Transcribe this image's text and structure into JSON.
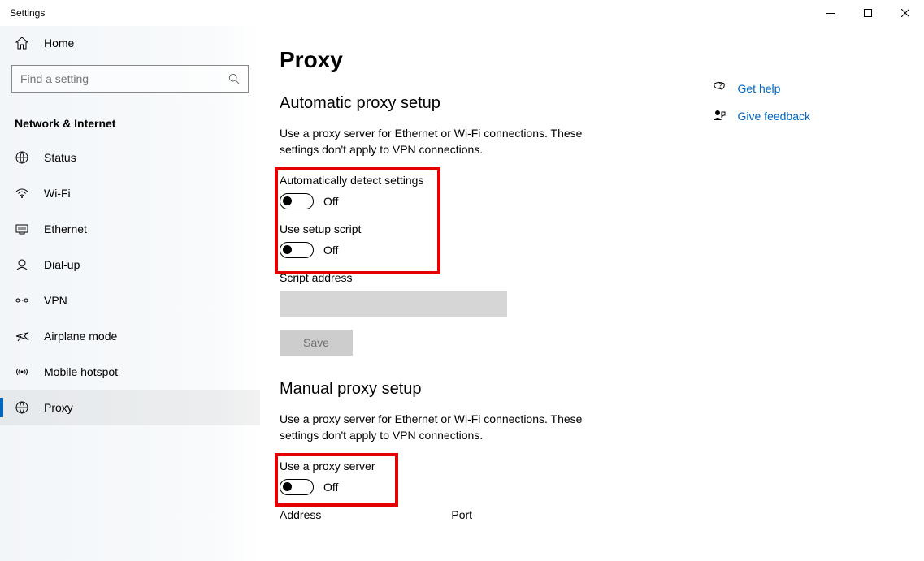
{
  "window": {
    "title": "Settings"
  },
  "sidebar": {
    "home_label": "Home",
    "search_placeholder": "Find a setting",
    "category": "Network & Internet",
    "items": [
      {
        "label": "Status",
        "icon": "status-icon"
      },
      {
        "label": "Wi-Fi",
        "icon": "wifi-icon"
      },
      {
        "label": "Ethernet",
        "icon": "ethernet-icon"
      },
      {
        "label": "Dial-up",
        "icon": "dialup-icon"
      },
      {
        "label": "VPN",
        "icon": "vpn-icon"
      },
      {
        "label": "Airplane mode",
        "icon": "airplane-icon"
      },
      {
        "label": "Mobile hotspot",
        "icon": "hotspot-icon"
      },
      {
        "label": "Proxy",
        "icon": "proxy-icon"
      }
    ]
  },
  "page": {
    "title": "Proxy",
    "auto": {
      "title": "Automatic proxy setup",
      "desc": "Use a proxy server for Ethernet or Wi-Fi connections. These settings don't apply to VPN connections.",
      "detect_label": "Automatically detect settings",
      "detect_state": "Off",
      "script_label": "Use setup script",
      "script_state": "Off",
      "script_address_label": "Script address",
      "script_address_value": "",
      "save_label": "Save"
    },
    "manual": {
      "title": "Manual proxy setup",
      "desc": "Use a proxy server for Ethernet or Wi-Fi connections. These settings don't apply to VPN connections.",
      "use_proxy_label": "Use a proxy server",
      "use_proxy_state": "Off",
      "address_label": "Address",
      "port_label": "Port"
    }
  },
  "links": {
    "get_help": "Get help",
    "give_feedback": "Give feedback"
  }
}
